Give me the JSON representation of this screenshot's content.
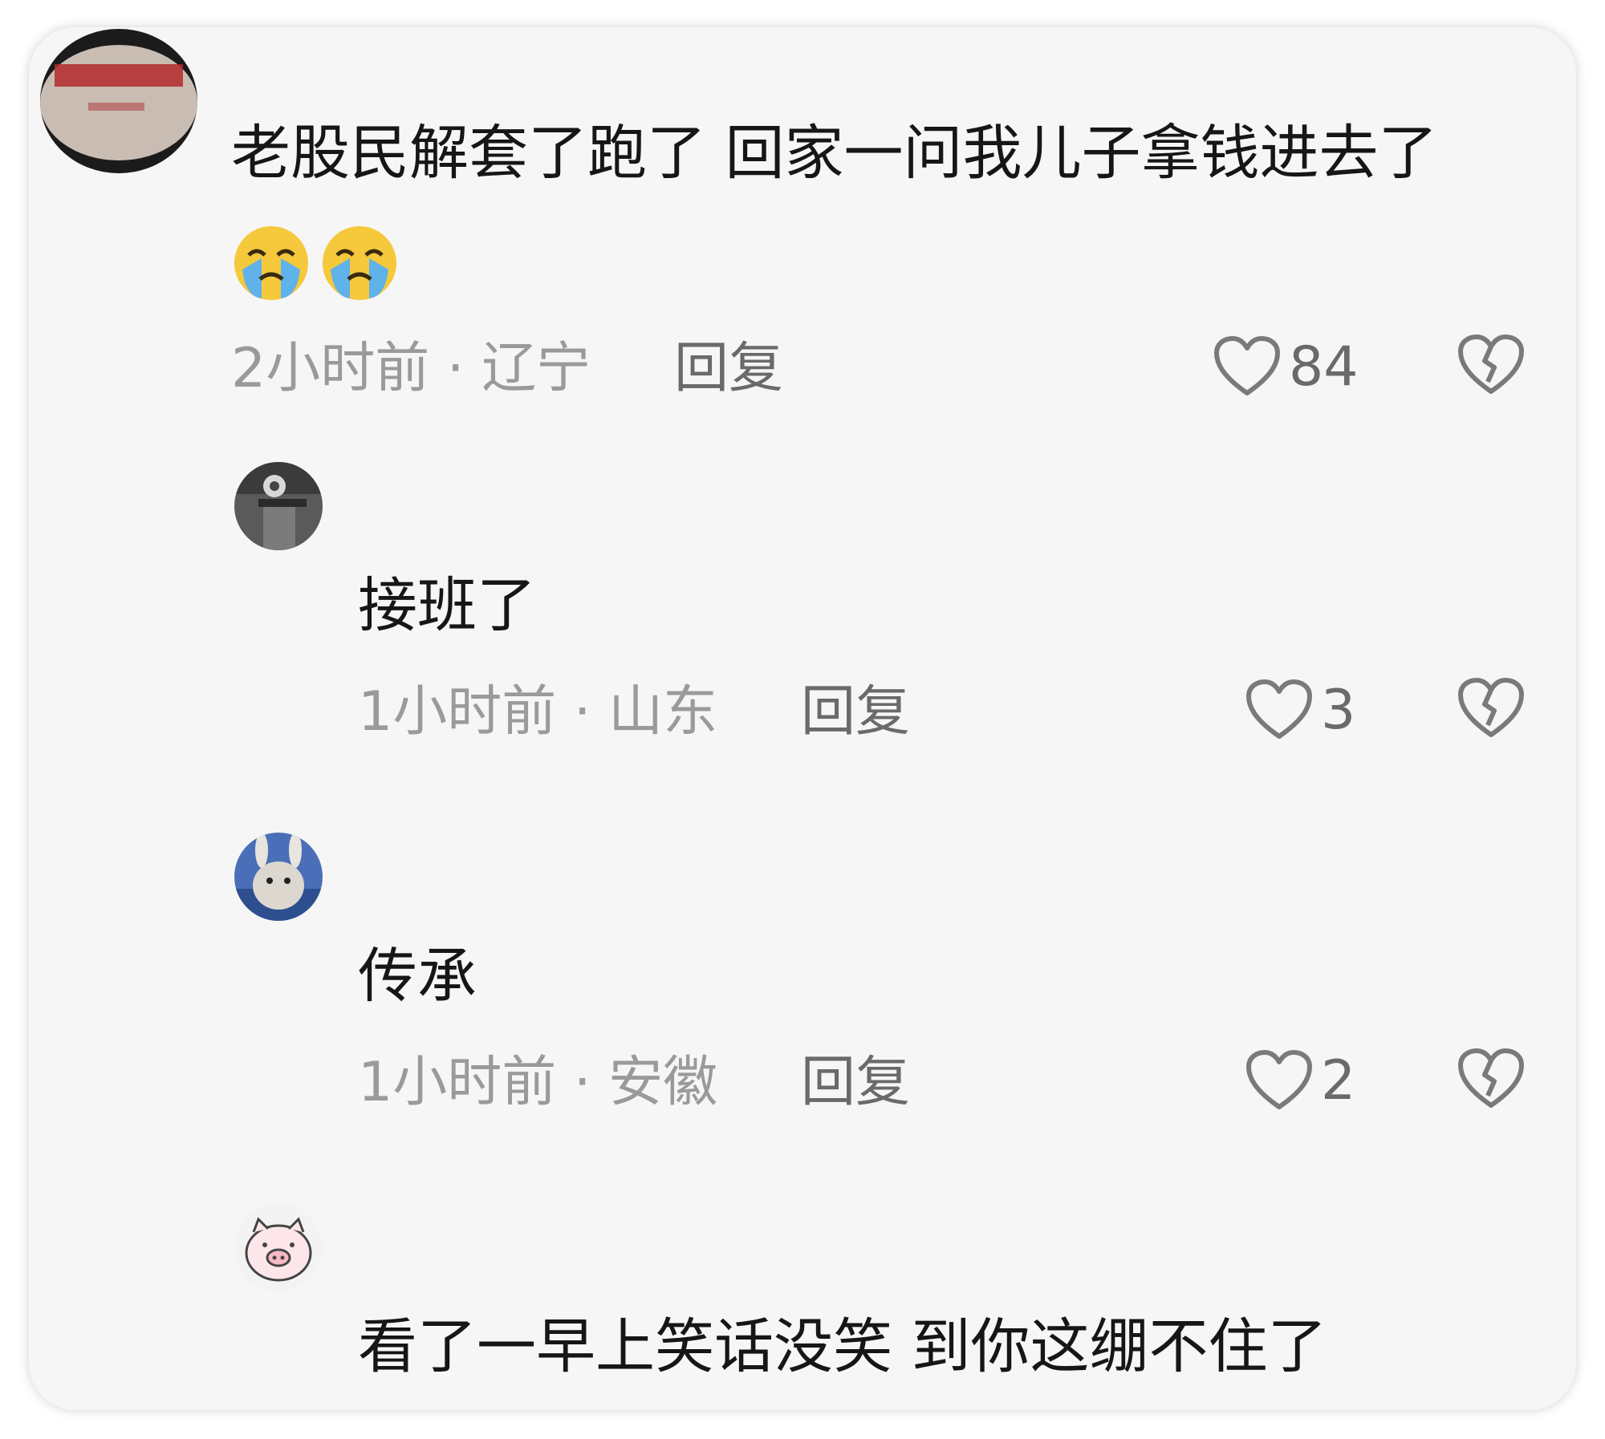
{
  "comments": [
    {
      "text": "老股民解套了跑了 回家一问我儿子拿钱进去了",
      "emojis": [
        "loudly-crying-face",
        "loudly-crying-face"
      ],
      "time": "2小时前",
      "location": "辽宁",
      "reply_label": "回复",
      "likes": "84",
      "avatar_icon": "red-seal-text-avatar"
    },
    {
      "text": "接班了",
      "time": "1小时前",
      "location": "山东",
      "reply_label": "回复",
      "likes": "3",
      "avatar_icon": "statue-photo-avatar"
    },
    {
      "text": "传承",
      "time": "1小时前",
      "location": "安徽",
      "reply_label": "回复",
      "likes": "2",
      "avatar_icon": "rabbit-photo-avatar"
    },
    {
      "text": "看了一早上笑话没笑 到你这绷不住了",
      "avatar_icon": "pig-avatar"
    }
  ],
  "meta_separator": " · ",
  "icons": {
    "like": "heart-outline-icon",
    "dislike": "broken-heart-icon"
  },
  "colors": {
    "card_bg": "#f6f6f6",
    "meta_text": "#9a9a9a",
    "icon_stroke": "#7a7a7a"
  }
}
